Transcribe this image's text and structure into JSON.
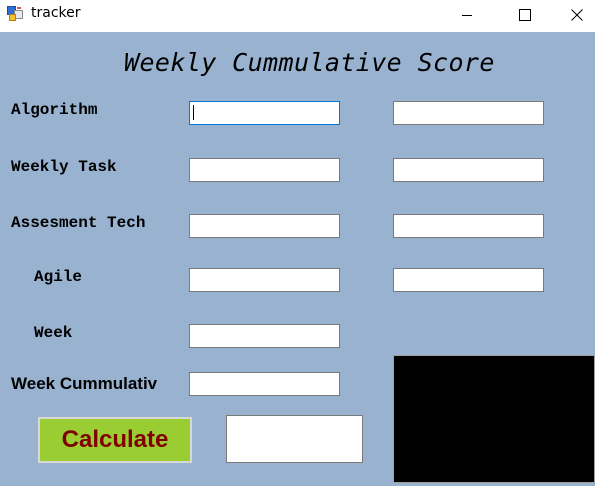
{
  "window": {
    "title": "tracker",
    "icon": "app-window-icon",
    "controls": {
      "minimize_icon": "minimize-icon",
      "maximize_icon": "maximize-icon",
      "close_icon": "close-icon"
    }
  },
  "form": {
    "heading": "Weekly Cummulative Score",
    "background_color": "#98b2d0",
    "rows": [
      {
        "label": "Algorithm",
        "input1": "",
        "input2": ""
      },
      {
        "label": "Weekly Task",
        "input1": "",
        "input2": ""
      },
      {
        "label": "Assesment Tech",
        "input1": "",
        "input2": ""
      },
      {
        "label": "Agile",
        "input1": "",
        "input2": ""
      },
      {
        "label": "Week",
        "input1": ""
      }
    ],
    "cumulative": {
      "label": "Week Cummulativ",
      "value": ""
    },
    "calculate_button": {
      "label": "Calculate",
      "bg_color": "#9acd32",
      "text_color": "#800000"
    },
    "result_value": "",
    "output_panel_color": "#000000"
  }
}
